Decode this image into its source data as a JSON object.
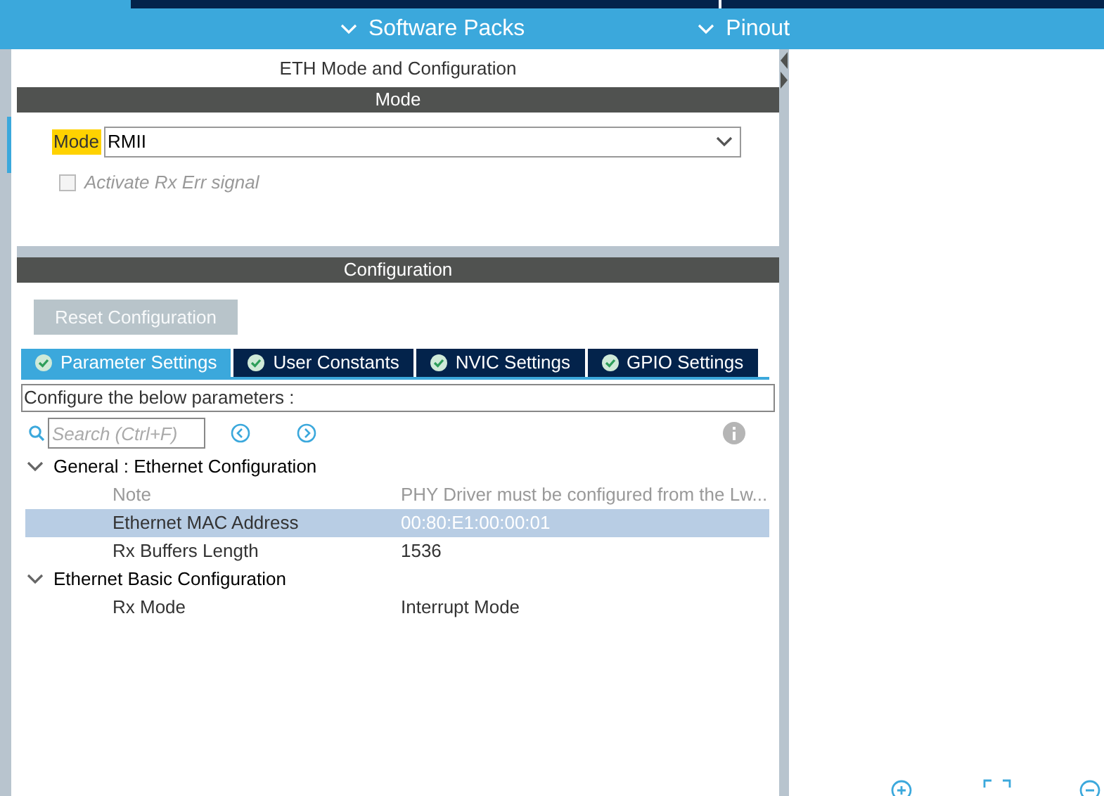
{
  "top_bar": {
    "menus": [
      {
        "label": "Software Packs"
      },
      {
        "label": "Pinout"
      }
    ]
  },
  "panel": {
    "title": "ETH Mode and Configuration",
    "mode_section": {
      "header": "Mode",
      "field_label": "Mode",
      "value": "RMII",
      "options": [
        {
          "label": "Activate Rx Err signal",
          "checked": false,
          "disabled": true
        }
      ]
    },
    "configuration_section": {
      "header": "Configuration",
      "reset_button": {
        "label": "Reset Configuration",
        "disabled": true
      },
      "tabs": [
        {
          "label": "Parameter Settings",
          "selected": true
        },
        {
          "label": "User Constants",
          "selected": false
        },
        {
          "label": "NVIC Settings",
          "selected": false
        },
        {
          "label": "GPIO Settings",
          "selected": false
        }
      ],
      "hint": "Configure the below parameters :",
      "search": {
        "placeholder": "Search (Ctrl+F)"
      },
      "groups": [
        {
          "label": "General : Ethernet Configuration",
          "expanded": true,
          "children": [
            {
              "name": "Note",
              "value": "PHY Driver must be configured from the Lw...",
              "disabled": true,
              "selected": false
            },
            {
              "name": "Ethernet MAC Address",
              "value": "00:80:E1:00:00:01",
              "disabled": false,
              "selected": true
            },
            {
              "name": "Rx Buffers Length",
              "value": "1536",
              "disabled": false,
              "selected": false
            }
          ]
        },
        {
          "label": "Ethernet Basic Configuration",
          "expanded": true,
          "children": [
            {
              "name": "Rx Mode",
              "value": "Interrupt Mode",
              "disabled": false,
              "selected": false
            }
          ]
        }
      ]
    }
  }
}
